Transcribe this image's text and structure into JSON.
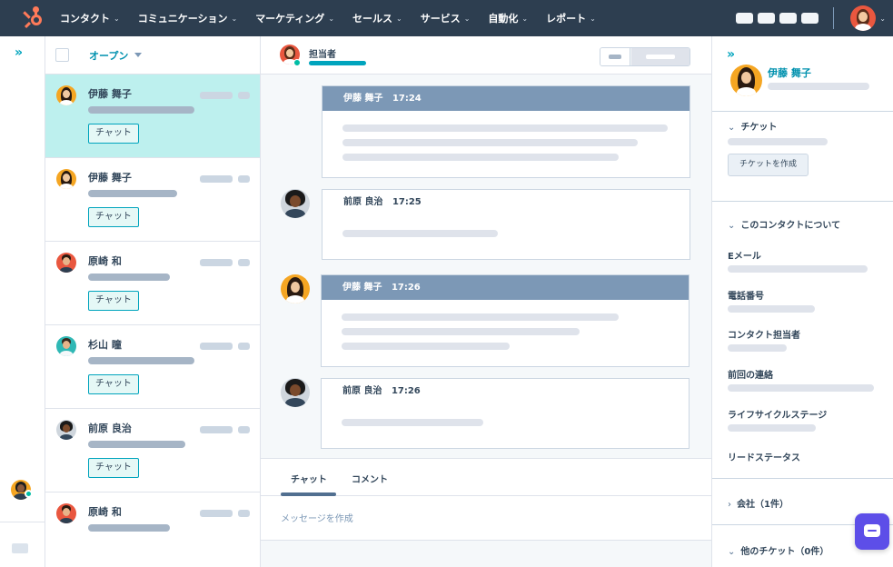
{
  "nav": {
    "items": [
      {
        "label": "コンタクト"
      },
      {
        "label": "コミュニケーション"
      },
      {
        "label": "マーケティング"
      },
      {
        "label": "セールス"
      },
      {
        "label": "サービス"
      },
      {
        "label": "自動化"
      },
      {
        "label": "レポート"
      }
    ]
  },
  "inbox": {
    "filter_label": "オープン",
    "tag_label": "チャット",
    "conversations": [
      {
        "name": "伊藤 舞子",
        "active": true,
        "has_tag": true
      },
      {
        "name": "伊藤 舞子",
        "active": false,
        "has_tag": true
      },
      {
        "name": "原崎 和",
        "active": false,
        "has_tag": true
      },
      {
        "name": "杉山 瞳",
        "active": false,
        "has_tag": true
      },
      {
        "name": "前原 良治",
        "active": false,
        "has_tag": true
      },
      {
        "name": "原崎 和",
        "active": false,
        "has_tag": false
      }
    ]
  },
  "thread": {
    "owner_label": "担当者",
    "messages": [
      {
        "sender": "伊藤 舞子",
        "time": "17:24",
        "highlight": true
      },
      {
        "sender": "前原 良治",
        "time": "17:25",
        "highlight": false
      },
      {
        "sender": "伊藤 舞子",
        "time": "17:26",
        "highlight": true
      },
      {
        "sender": "前原 良治",
        "time": "17:26",
        "highlight": false
      }
    ],
    "composer": {
      "tab_chat": "チャット",
      "tab_comment": "コメント",
      "placeholder": "メッセージを作成"
    }
  },
  "sidebar": {
    "contact_name": "伊藤 舞子",
    "ticket_section": "チケット",
    "create_ticket_button": "チケットを作成",
    "about_section": "このコンタクトについて",
    "fields": [
      {
        "label": "Eメール"
      },
      {
        "label": "電話番号"
      },
      {
        "label": "コンタクト担当者"
      },
      {
        "label": "前回の連絡"
      },
      {
        "label": "ライフサイクルステージ"
      },
      {
        "label": "リードステータス"
      }
    ],
    "company_section": "会社（1件）",
    "other_tickets_section": "他のチケット（0件）"
  },
  "colors": {
    "nav_bg": "#2d3e50",
    "accent": "#00a4bd",
    "active_row": "#bdf0ee",
    "message_header": "#7c98b6",
    "launcher": "#5d4ee8"
  }
}
